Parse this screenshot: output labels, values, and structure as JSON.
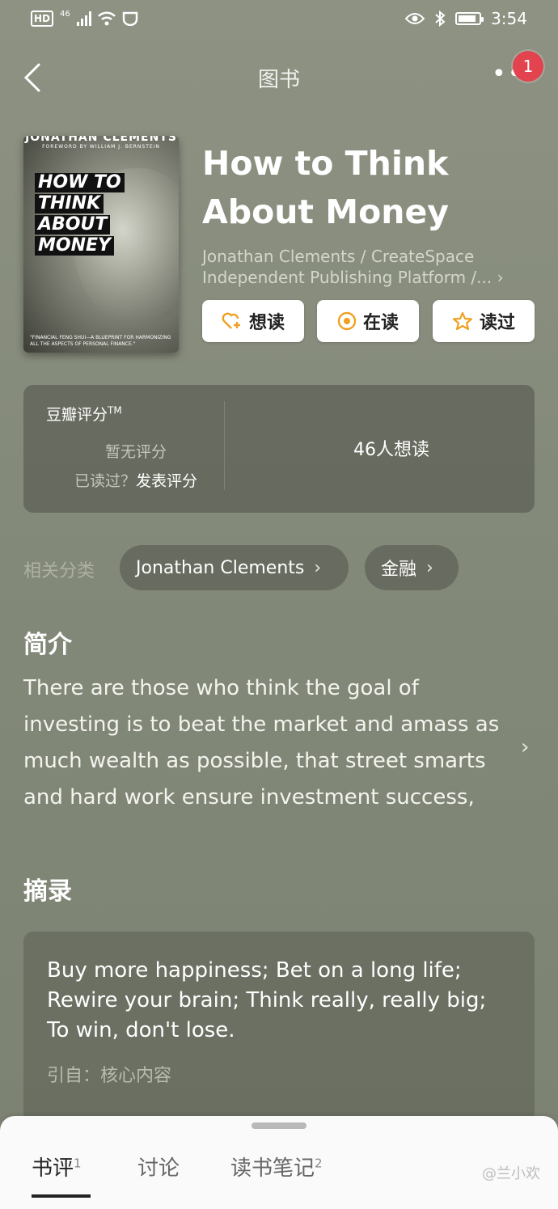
{
  "status_bar": {
    "network_label": "HD",
    "signal_label": "46",
    "time": "3:54"
  },
  "header": {
    "title": "图书",
    "notification_count": "1"
  },
  "book": {
    "cover_author": "JONATHAN CLEMENTS",
    "cover_foreword": "FOREWORD BY WILLIAM J. BERNSTEIN",
    "cover_title_lines": [
      "HOW TO",
      "THINK",
      "ABOUT",
      "MONEY"
    ],
    "cover_tagline": "\"FINANCIAL FENG SHUI—A BLUEPRINT FOR HARMONIZING ALL THE ASPECTS OF PERSONAL FINANCE.\"",
    "title": "How to Think About Money",
    "publisher_line1": "Jonathan Clements / CreateSpace",
    "publisher_line2": "Independent Publishing Platform /...",
    "buttons": {
      "want": "想读",
      "reading": "在读",
      "read": "读过"
    }
  },
  "rating": {
    "label": "豆瓣评分",
    "trademark": "TM",
    "no_rating": "暂无评分",
    "read_prompt": "已读过？",
    "post_rating": "发表评分",
    "want_count": "46人想读"
  },
  "categories": {
    "label": "相关分类",
    "items": [
      "Jonathan Clements",
      "金融"
    ]
  },
  "intro": {
    "heading": "简介",
    "text": "There are those who think the goal of investing is to beat the market and amass as much wealth as possible, that street smarts and hard work ensure investment success,"
  },
  "excerpt": {
    "heading": "摘录",
    "text": "Buy more happiness; Bet on a long life; Rewire your brain; Think really, really big; To win, don't lose.",
    "source": "引自：核心内容"
  },
  "bottom_tabs": {
    "reviews": "书评",
    "reviews_count": "1",
    "discussion": "讨论",
    "notes": "读书笔记",
    "notes_count": "2"
  },
  "watermark": "@兰小欢",
  "colors": {
    "background": "#868b7b",
    "badge": "#e2434e",
    "accent_icon": "#f0a020"
  }
}
